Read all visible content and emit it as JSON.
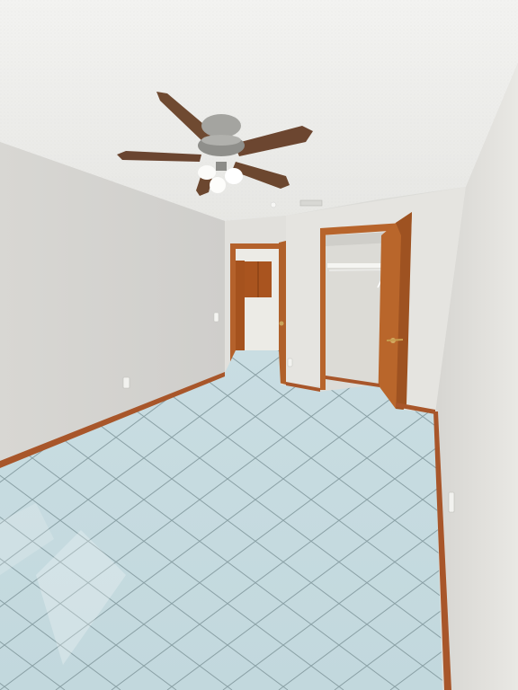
{
  "scene": {
    "type": "photo",
    "watermark": "",
    "colors": {
      "ceiling": "#efefec",
      "wall_left": "#dad9d5",
      "wall_back": "#e4e3df",
      "wall_right": "#e2e1dd",
      "floor_tile": "#c5dbe0",
      "grout": "#8fa3a8",
      "baseboard": "#a9552a",
      "door_wood": "#b8642c",
      "fan_blade": "#6e4a33",
      "fan_metal": "#9a9a96"
    }
  }
}
